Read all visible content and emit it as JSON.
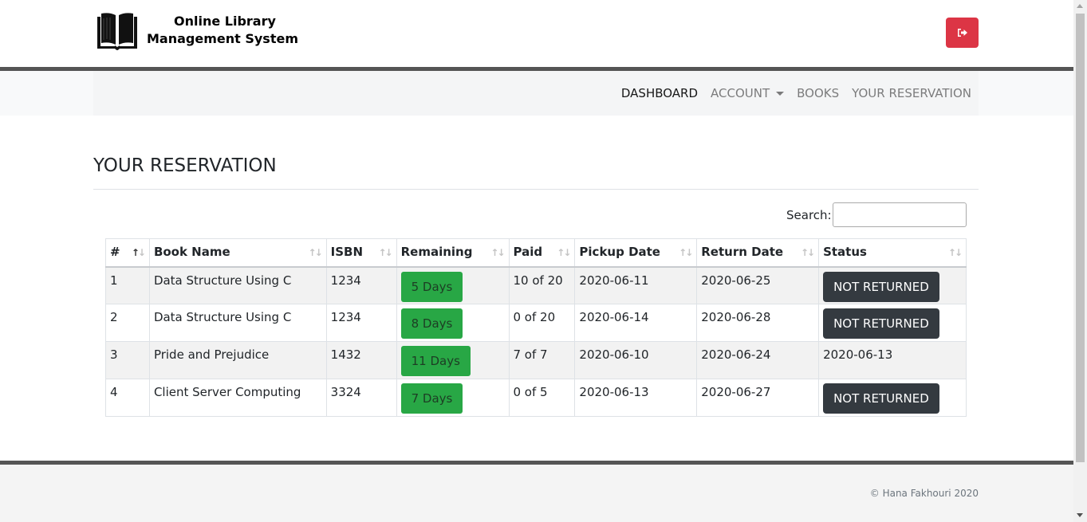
{
  "header": {
    "brand_line1": "Online Library",
    "brand_line2": "Management System",
    "logo_icon": "book-icon",
    "logout_icon": "sign-out-icon",
    "logout_color": "#dc3545"
  },
  "nav": {
    "items": [
      {
        "label": "DASHBOARD",
        "active": true
      },
      {
        "label": "ACCOUNT",
        "dropdown": true
      },
      {
        "label": "BOOKS"
      },
      {
        "label": "YOUR RESERVATION"
      }
    ]
  },
  "main": {
    "title": "YOUR RESERVATION",
    "search_label": "Search:",
    "search_value": ""
  },
  "table": {
    "columns": [
      "#",
      "Book Name",
      "ISBN",
      "Remaining",
      "Paid",
      "Pickup Date",
      "Return Date",
      "Status"
    ],
    "rows": [
      {
        "num": "1",
        "book": "Data Structure Using C",
        "isbn": "1234",
        "remaining": "5 Days",
        "paid": "10 of 20",
        "pickup": "2020-06-11",
        "return": "2020-06-25",
        "status": "NOT RETURNED",
        "status_is_button": true
      },
      {
        "num": "2",
        "book": "Data Structure Using C",
        "isbn": "1234",
        "remaining": "8 Days",
        "paid": "0 of 20",
        "pickup": "2020-06-14",
        "return": "2020-06-28",
        "status": "NOT RETURNED",
        "status_is_button": true
      },
      {
        "num": "3",
        "book": "Pride and Prejudice",
        "isbn": "1432",
        "remaining": "11 Days",
        "paid": "7 of 7",
        "pickup": "2020-06-10",
        "return": "2020-06-24",
        "status": "2020-06-13",
        "status_is_button": false
      },
      {
        "num": "4",
        "book": "Client Server Computing",
        "isbn": "3324",
        "remaining": "7 Days",
        "paid": "0 of 5",
        "pickup": "2020-06-13",
        "return": "2020-06-27",
        "status": "NOT RETURNED",
        "status_is_button": true
      }
    ],
    "remaining_color": "#28a745",
    "status_button_color": "#343a40"
  },
  "footer": {
    "copyright": "© Hana Fakhouri 2020"
  }
}
